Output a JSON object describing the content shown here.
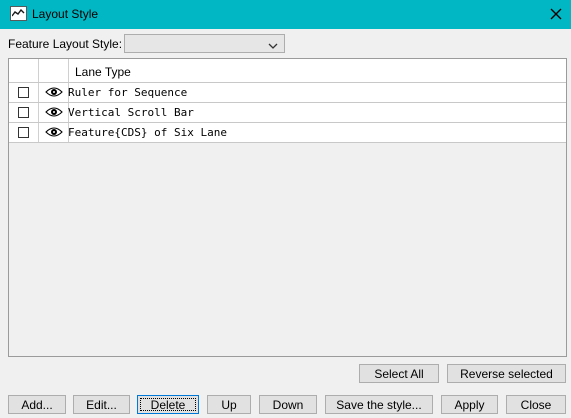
{
  "window": {
    "title": "Layout Style",
    "accent_color": "#00b7c3"
  },
  "feature_layout": {
    "label": "Feature Layout Style:",
    "selected_value": ""
  },
  "table": {
    "columns": [
      "",
      "",
      "Lane Type"
    ],
    "rows": [
      {
        "checked": false,
        "visible": true,
        "lane_type": "Ruler for Sequence"
      },
      {
        "checked": false,
        "visible": true,
        "lane_type": "Vertical Scroll Bar"
      },
      {
        "checked": false,
        "visible": true,
        "lane_type": "Feature{CDS} of Six Lane"
      }
    ]
  },
  "selection_buttons": {
    "select_all": "Select All",
    "reverse_selected": "Reverse selected"
  },
  "bottom_buttons": {
    "add": "Add...",
    "edit": "Edit...",
    "delete": "Delete",
    "up": "Up",
    "down": "Down",
    "save_style": "Save the style...",
    "apply": "Apply",
    "close": "Close"
  },
  "icons": {
    "app": "app-icon",
    "close": "close-icon",
    "dropdown": "chevron-down-icon",
    "visibility": "eye-icon"
  }
}
